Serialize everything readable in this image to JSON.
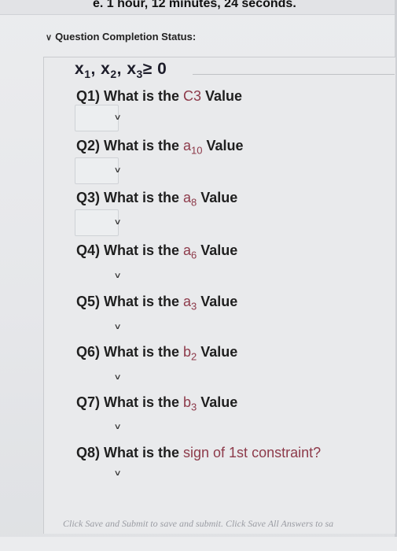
{
  "timer": {
    "text": "e. 1 hour, 12 minutes, 24 seconds."
  },
  "status": {
    "icon": "chevron-down-double-icon",
    "label": "Question Completion Status:"
  },
  "constraint_formula": {
    "x1": "x",
    "s1": "1",
    "x2": "x",
    "s2": "2",
    "x3": "x",
    "s3": "3",
    "tail": "≥ 0"
  },
  "questions": [
    {
      "prefix": "Q1) What is the ",
      "var": "C3",
      "sub": "",
      "suffix": " Value",
      "selected": ""
    },
    {
      "prefix": "Q2) What is the ",
      "var": "a",
      "sub": "10",
      "suffix": " Value",
      "selected": ""
    },
    {
      "prefix": "Q3) What is the ",
      "var": "a",
      "sub": "8",
      "suffix": " Value",
      "selected": ""
    },
    {
      "prefix": "Q4) What is the ",
      "var": "a",
      "sub": "6",
      "suffix": " Value",
      "selected": ""
    },
    {
      "prefix": "Q5) What is the ",
      "var": "a",
      "sub": "3",
      "suffix": " Value",
      "selected": ""
    },
    {
      "prefix": "Q6) What is the ",
      "var": "b",
      "sub": "2",
      "suffix": " Value",
      "selected": ""
    },
    {
      "prefix": "Q7) What is the ",
      "var": "b",
      "sub": "3",
      "suffix": " Value",
      "selected": ""
    },
    {
      "prefix": "Q8) What is the ",
      "var": "sign of 1st constraint?",
      "sub": "",
      "suffix": "",
      "selected": ""
    }
  ],
  "dropdown_arrow_icon": "chevron-down-icon",
  "footer": {
    "text": "Click Save and Submit to save and submit. Click Save All Answers to sa"
  }
}
